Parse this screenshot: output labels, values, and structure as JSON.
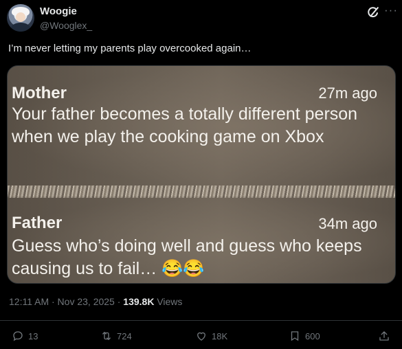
{
  "author": {
    "name": "Woogie",
    "handle": "@Wooglex_"
  },
  "tweet": {
    "text": "I’m never letting my parents play overcooked again…"
  },
  "image": {
    "messages": [
      {
        "sender": "Mother",
        "time": "27m ago",
        "text": "Your father becomes a totally different person when we play the cooking game on Xbox"
      },
      {
        "sender": "Father",
        "time": "34m ago",
        "text": "Guess who’s doing well and guess who keeps causing us to fail… 😂😂"
      }
    ]
  },
  "meta": {
    "timestamp": "12:11 AM · Nov 23, 2025 · ",
    "views_count": "139.8K",
    "views_label": " Views"
  },
  "actions": {
    "replies": "13",
    "reposts": "724",
    "likes": "18K",
    "bookmarks": "600"
  },
  "colors": {
    "background": "#000000",
    "text": "#e7e9ea",
    "muted": "#71767b",
    "divider": "#2f3336"
  }
}
